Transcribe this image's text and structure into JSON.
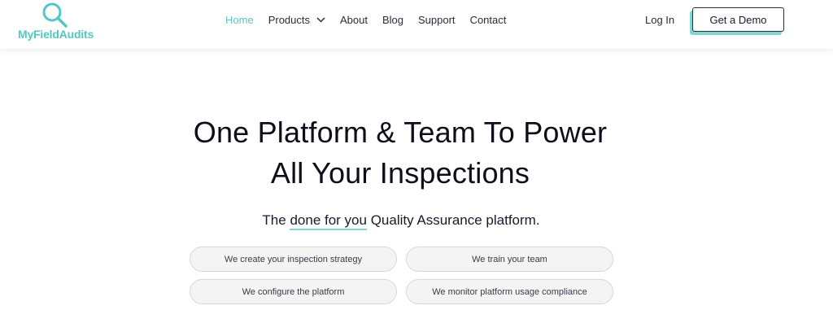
{
  "header": {
    "logo_text": "MyFieldAudits",
    "nav": [
      {
        "label": "Home",
        "active": true
      },
      {
        "label": "Products",
        "dropdown": true
      },
      {
        "label": "About"
      },
      {
        "label": "Blog"
      },
      {
        "label": "Support"
      },
      {
        "label": "Contact"
      }
    ],
    "login_label": "Log In",
    "demo_label": "Get a Demo"
  },
  "hero": {
    "title_line1": "One Platform & Team To Power",
    "title_line2": "All Your Inspections",
    "subtitle_prefix": "The ",
    "subtitle_emphasis": "done for you",
    "subtitle_suffix": " Quality Assurance platform."
  },
  "features": [
    "We create your inspection strategy",
    "We train your team",
    "We configure the platform",
    "We monitor platform usage compliance"
  ],
  "colors": {
    "accent": "#5cc6c3",
    "highlight": "#c7ecea",
    "text": "#1a1a2e"
  }
}
